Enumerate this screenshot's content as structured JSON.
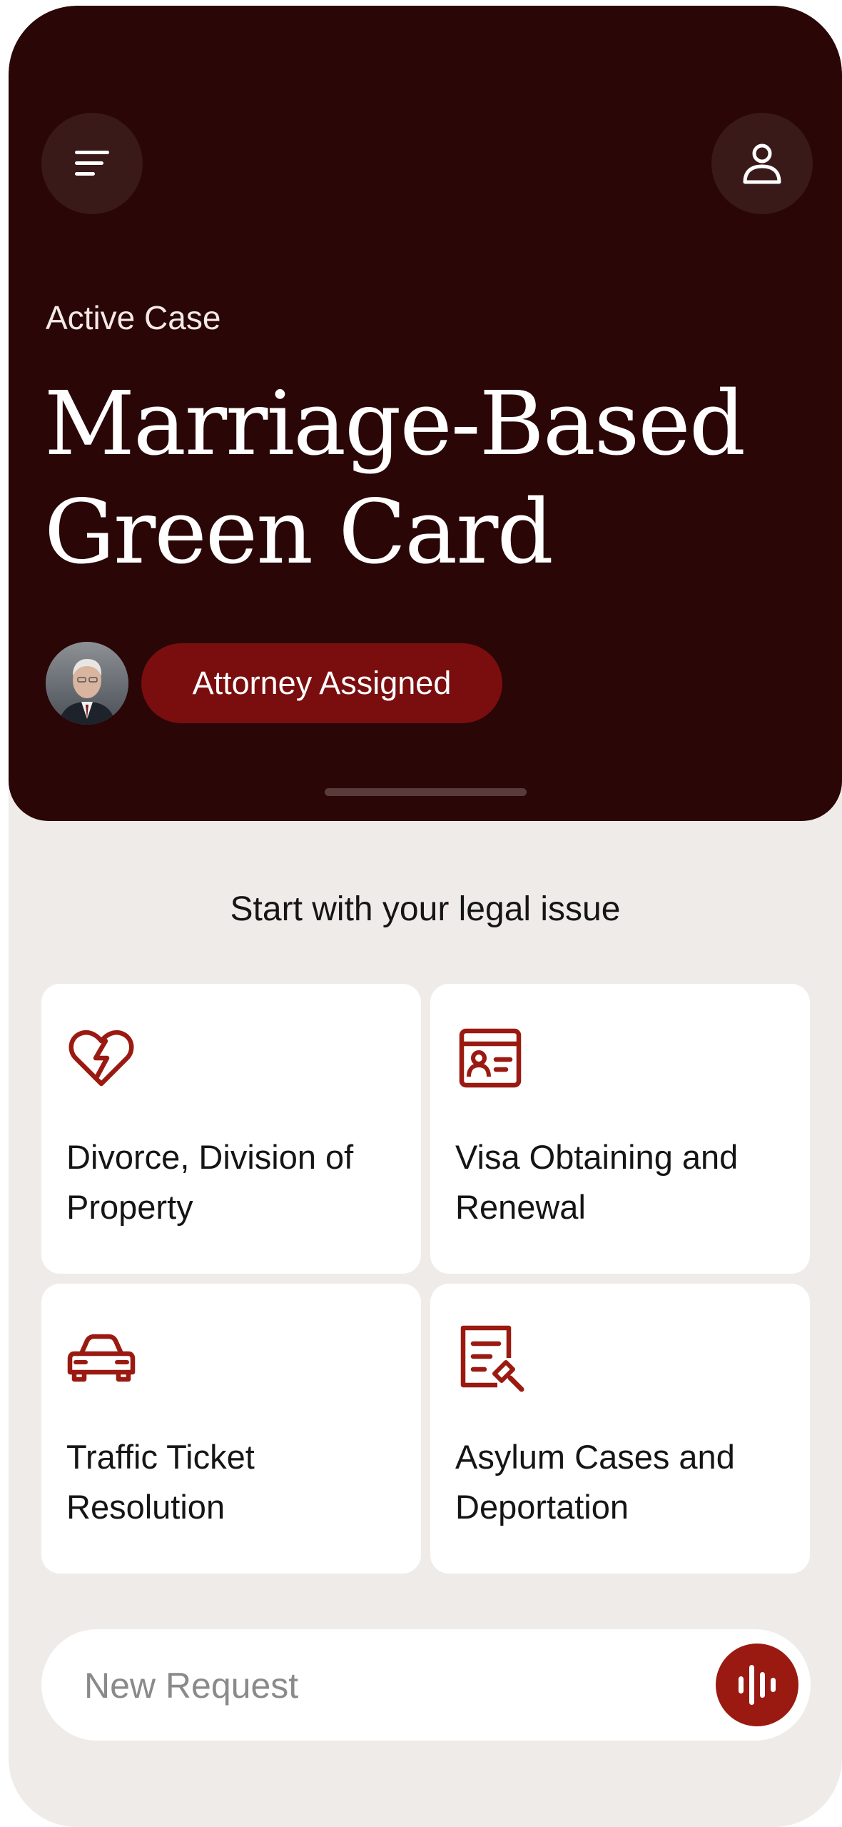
{
  "header": {
    "eyebrow": "Active Case",
    "case_title": "Marriage-Based Green Card",
    "status_badge": "Attorney Assigned"
  },
  "icons": {
    "menu": "menu-lines-icon",
    "profile": "user-icon",
    "voice": "voice-waveform-icon"
  },
  "section_title": "Start with your legal issue",
  "categories": [
    {
      "label": "Divorce, Division of Property",
      "icon": "broken-heart-icon"
    },
    {
      "label": "Visa Obtaining and Renewal",
      "icon": "id-card-icon"
    },
    {
      "label": "Traffic Ticket Resolution",
      "icon": "car-icon"
    },
    {
      "label": "Asylum Cases and Deportation",
      "icon": "document-search-icon"
    }
  ],
  "request": {
    "placeholder": "New Request",
    "value": ""
  },
  "colors": {
    "hero_bg": "#2a0606",
    "accent": "#9a1a12",
    "badge_bg": "#7a0e0e",
    "page_bg": "#efebe8"
  }
}
